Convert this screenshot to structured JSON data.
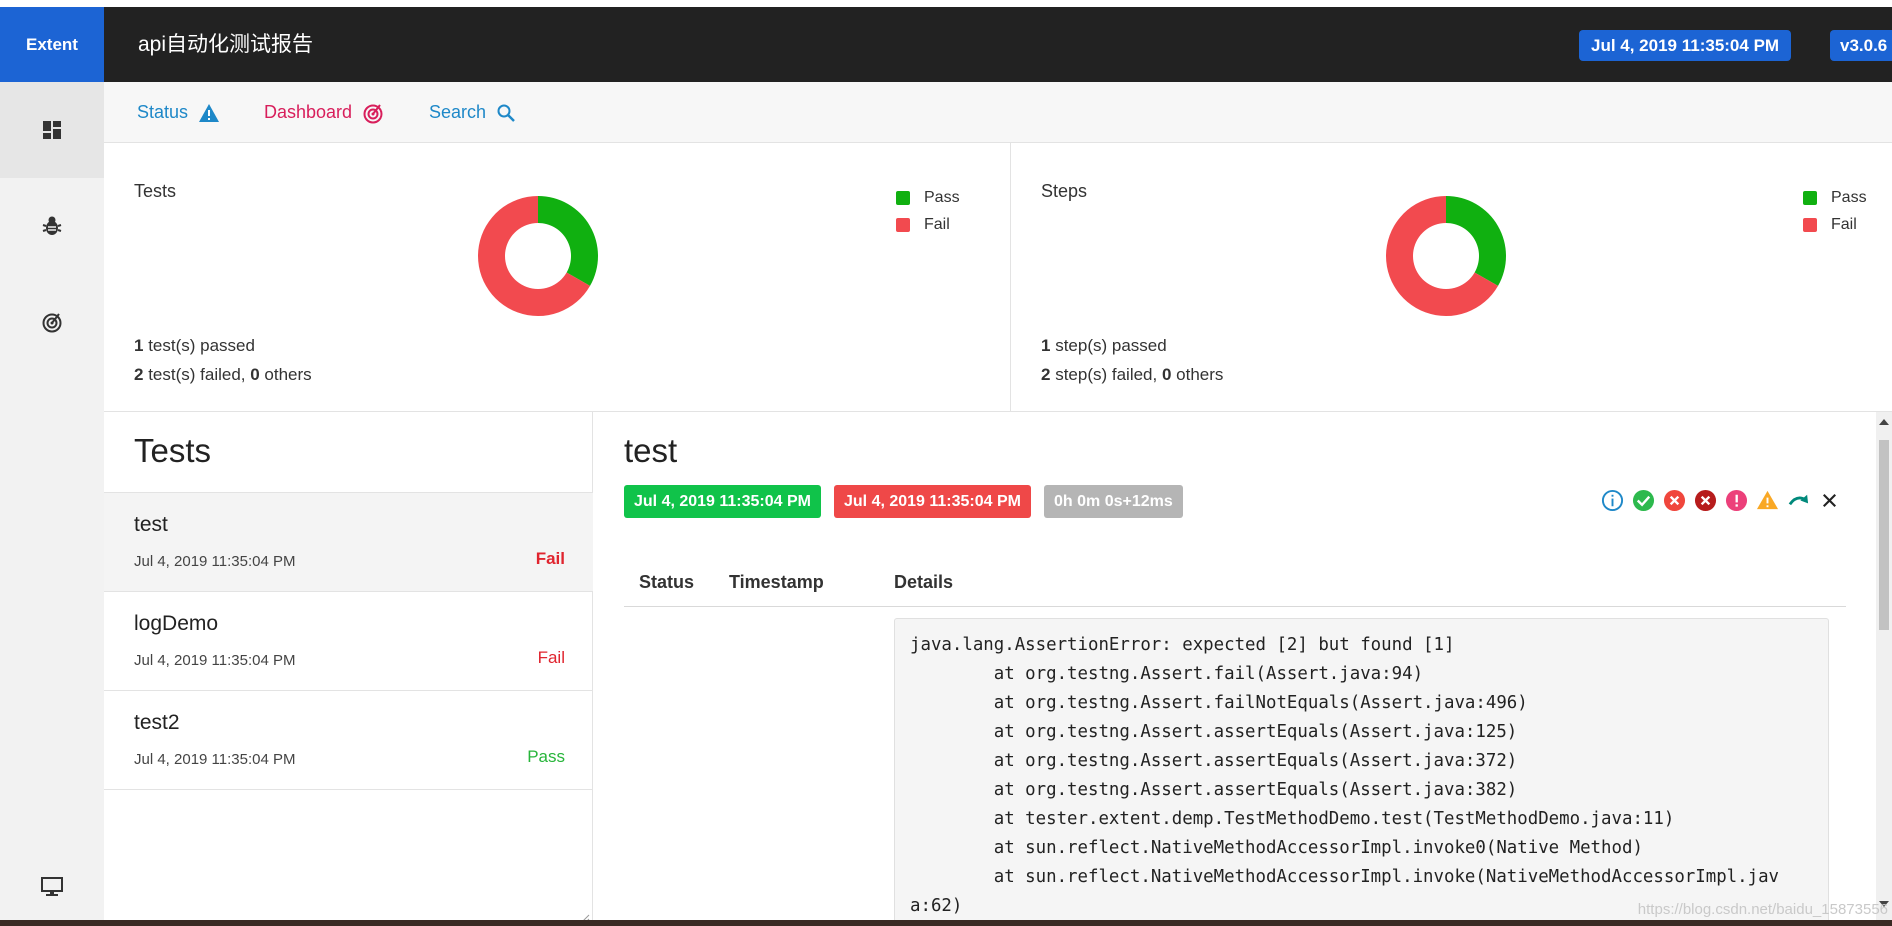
{
  "header": {
    "brand": "Extent",
    "report_name": "api自动化测试报告",
    "date": "Jul 4, 2019 11:35:04 PM",
    "version": "v3.0.6"
  },
  "sidenav": {
    "icons": [
      "dashboard-icon",
      "bug-icon",
      "radar-icon",
      "monitor-icon"
    ]
  },
  "tabs": [
    {
      "label": "Status",
      "icon": "warning-icon",
      "color": "#1e88c8"
    },
    {
      "label": "Dashboard",
      "icon": "radar-icon",
      "color": "#d81e5b"
    },
    {
      "label": "Search",
      "icon": "search-icon",
      "color": "#1e88c8"
    }
  ],
  "colors": {
    "pass": "#10b010",
    "fail": "#f24a4f",
    "accent": "#1c64d4"
  },
  "tests_card": {
    "title": "Tests",
    "legend": [
      "Pass",
      "Fail"
    ],
    "passed_count": "1",
    "passed_text": " test(s) passed",
    "failed_count": "2",
    "failed_text": " test(s) failed, ",
    "others_count": "0",
    "others_text": " others",
    "pass_fraction": 0.333
  },
  "steps_card": {
    "title": "Steps",
    "legend": [
      "Pass",
      "Fail"
    ],
    "passed_count": "1",
    "passed_text": " step(s) passed",
    "failed_count": "2",
    "failed_text": " step(s) failed, ",
    "others_count": "0",
    "others_text": " others",
    "pass_fraction": 0.333
  },
  "test_list": {
    "heading": "Tests",
    "items": [
      {
        "name": "test",
        "time": "Jul 4, 2019 11:35:04 PM",
        "status": "Fail"
      },
      {
        "name": "logDemo",
        "time": "Jul 4, 2019 11:35:04 PM",
        "status": "Fail"
      },
      {
        "name": "test2",
        "time": "Jul 4, 2019 11:35:04 PM",
        "status": "Pass"
      }
    ]
  },
  "detail": {
    "title": "test",
    "start_time": "Jul 4, 2019 11:35:04 PM",
    "end_time": "Jul 4, 2019 11:35:04 PM",
    "duration": "0h 0m 0s+12ms",
    "filter_icons": [
      "info-icon",
      "pass-check-icon",
      "fail-icon",
      "fatal-icon",
      "error-icon",
      "warning-icon",
      "skip-icon",
      "close-icon"
    ],
    "columns": [
      "Status",
      "Timestamp",
      "Details"
    ],
    "stacktrace": "java.lang.AssertionError: expected [2] but found [1]\n\tat org.testng.Assert.fail(Assert.java:94)\n\tat org.testng.Assert.failNotEquals(Assert.java:496)\n\tat org.testng.Assert.assertEquals(Assert.java:125)\n\tat org.testng.Assert.assertEquals(Assert.java:372)\n\tat org.testng.Assert.assertEquals(Assert.java:382)\n\tat tester.extent.demp.TestMethodDemo.test(TestMethodDemo.java:11)\n\tat sun.reflect.NativeMethodAccessorImpl.invoke0(Native Method)\n\tat sun.reflect.NativeMethodAccessorImpl.invoke(NativeMethodAccessorImpl.jav\na:62)"
  },
  "watermark": "https://blog.csdn.net/baidu_15873556"
}
